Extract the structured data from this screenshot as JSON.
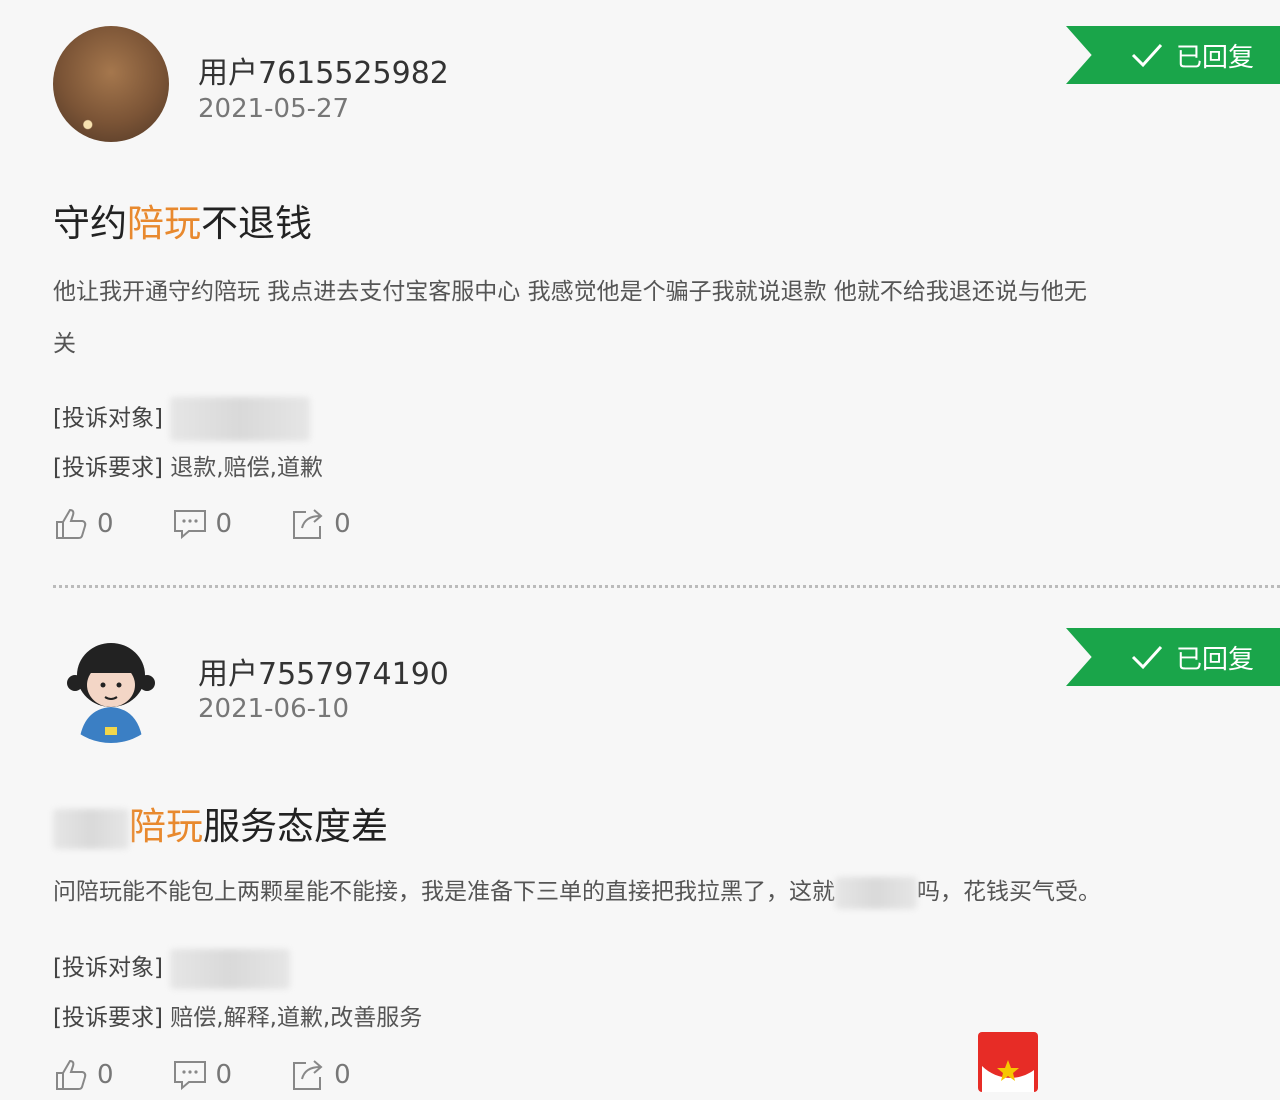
{
  "badge_label": "已回复",
  "complaints": [
    {
      "username": "用户7615525982",
      "date": "2021-05-27",
      "title_pre": "守约",
      "title_hl": "陪玩",
      "title_post": "不退钱",
      "body_line1": "他让我开通守约陪玩 我点进去支付宝客服中心 我感觉他是个骗子我就说退款 他就不给我退还说与他无",
      "body_line2": "关",
      "target_label": "[投诉对象]",
      "demand_label": "[投诉要求]",
      "demand_value": "退款,赔偿,道歉",
      "likes": "0",
      "comments": "0",
      "shares": "0"
    },
    {
      "username": "用户7557974190",
      "date": "2021-06-10",
      "title_hl": "陪玩",
      "title_post": "服务态度差",
      "body_pre": "问陪玩能不能包上两颗星能不能接，我是准备下三单的直接把我拉黑了，这就",
      "body_post": "吗，花钱买气受。",
      "target_label": "[投诉对象]",
      "demand_label": "[投诉要求]",
      "demand_value": "赔偿,解释,道歉,改善服务",
      "likes": "0",
      "comments": "0",
      "shares": "0"
    }
  ],
  "colors": {
    "badge": "#1aa54a",
    "highlight": "#e8892e",
    "logo": "#e72c26"
  },
  "icons": [
    "thumbs-up-icon",
    "comment-icon",
    "share-icon",
    "check-icon"
  ]
}
